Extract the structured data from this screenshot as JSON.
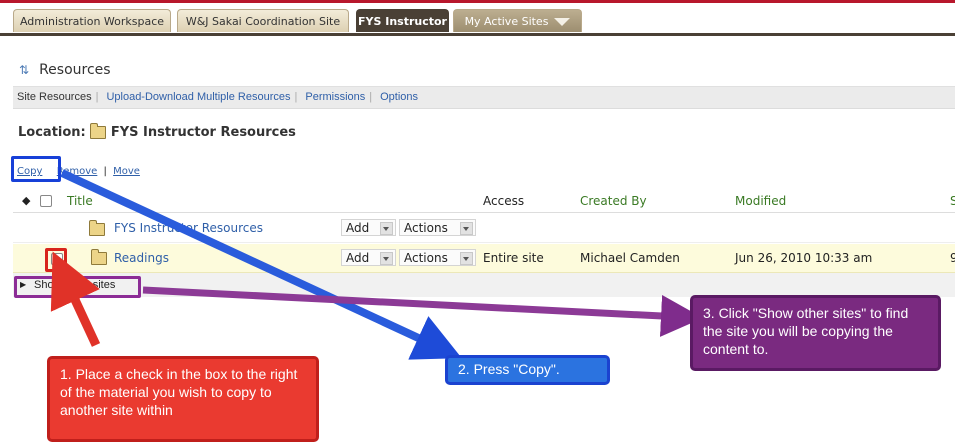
{
  "tabs": [
    {
      "label": "Administration Workspace"
    },
    {
      "label": "W&J Sakai Coordination Site"
    },
    {
      "label": "FYS Instructor"
    },
    {
      "label": "My Active Sites"
    }
  ],
  "tool": {
    "title": "Resources",
    "icon": "resources-icon"
  },
  "navbar": {
    "items": [
      "Site Resources",
      "Upload-Download Multiple Resources",
      "Permissions",
      "Options"
    ]
  },
  "location": {
    "label": "Location:",
    "value": "FYS Instructor Resources"
  },
  "actions": {
    "copy": "Copy",
    "remove": "Remove",
    "move": "Move",
    "separator": "|"
  },
  "table": {
    "headers": {
      "title": "Title",
      "access": "Access",
      "created_by": "Created By",
      "modified": "Modified",
      "size": "S"
    },
    "rows": [
      {
        "title": "FYS Instructor Resources",
        "add": "Add",
        "actions": "Actions",
        "access": "",
        "created_by": "",
        "modified": "",
        "size": ""
      },
      {
        "title": "Readings",
        "add": "Add",
        "actions": "Actions",
        "access": "Entire site",
        "created_by": "Michael Camden",
        "modified": "Jun 26, 2010 10:33 am",
        "size": "9"
      }
    ],
    "show_other_sites": "Show other sites"
  },
  "callouts": {
    "step1": "1. Place a check in the box to the right of the material you wish to copy to another site within",
    "step2": "2. Press \"Copy\".",
    "step3": "3. Click \"Show other sites\" to find the site you will be copying the content to."
  },
  "colors": {
    "tab_active": "#4a4035",
    "link": "#2f5fa8",
    "header_green": "#3a7a24",
    "callout_red": "#ea3a30",
    "callout_blue": "#2b73e0",
    "callout_purple": "#7a2a80"
  }
}
